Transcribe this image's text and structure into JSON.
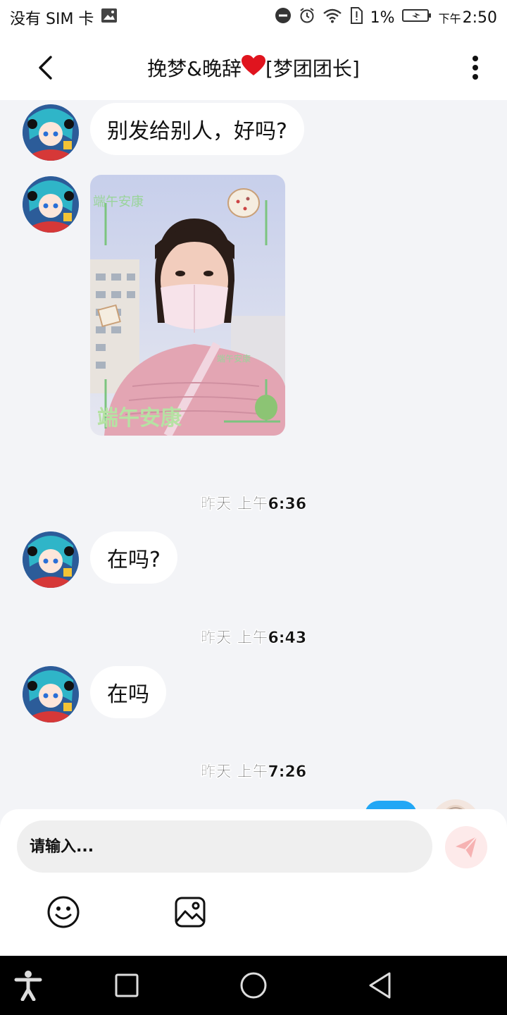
{
  "status_bar": {
    "carrier": "没有 SIM 卡",
    "battery": "1%",
    "ampm": "下午",
    "time": "2:50"
  },
  "header": {
    "title_prefix": "挽梦&晚辞",
    "title_suffix": "[梦团团长]",
    "heart_color": "#e0141e"
  },
  "messages": [
    {
      "type": "text",
      "text": "别发给别人，好吗?"
    },
    {
      "type": "image"
    },
    {
      "type": "timestamp",
      "text": "昨天 上午6:36"
    },
    {
      "type": "text",
      "text": "在吗?"
    },
    {
      "type": "timestamp",
      "text": "昨天 上午6:43"
    },
    {
      "type": "text",
      "text": "在吗"
    },
    {
      "type": "timestamp",
      "text": "昨天 上午7:26"
    }
  ],
  "input": {
    "placeholder": "请输入...",
    "value": ""
  },
  "colors": {
    "background": "#f3f4f7",
    "outgoing_bubble": "#22a7f5",
    "send_button": "#fdeaea",
    "send_icon": "#f6b2b2"
  },
  "icons": {
    "back": "chevron-left",
    "menu": "more-vertical",
    "send": "paper-plane",
    "emoji": "smiley-face",
    "image": "image-picture",
    "accessibility": "accessibility-figure",
    "recents": "square",
    "home": "circle",
    "back_nav": "triangle-left"
  }
}
